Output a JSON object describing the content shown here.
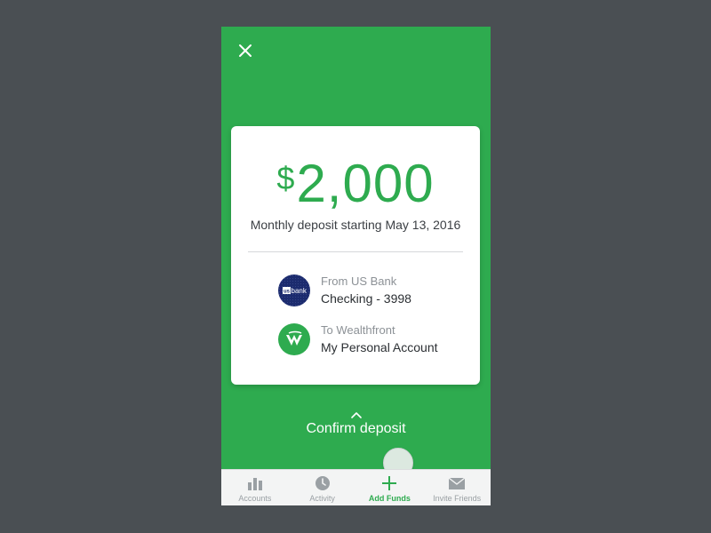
{
  "colors": {
    "brand_green": "#2eab4f",
    "backdrop": "#4a4f53",
    "usbank_blue": "#1c2b6e",
    "tab_inactive": "#9aa0a4"
  },
  "deposit": {
    "currency_symbol": "$",
    "amount": "2,000",
    "subtitle": "Monthly deposit starting May 13, 2016"
  },
  "from_account": {
    "label": "From US Bank",
    "name": "Checking - 3998",
    "logo_text": "bank",
    "icon": "us-bank-logo"
  },
  "to_account": {
    "label": "To Wealthfront",
    "name": "My Personal Account",
    "icon": "wealthfront-logo"
  },
  "confirm": {
    "label": "Confirm deposit"
  },
  "tabs": [
    {
      "label": "Accounts",
      "icon": "bar-chart-icon",
      "active": false
    },
    {
      "label": "Activity",
      "icon": "clock-icon",
      "active": false
    },
    {
      "label": "Add Funds",
      "icon": "plus-icon",
      "active": true
    },
    {
      "label": "Invite Friends",
      "icon": "envelope-icon",
      "active": false
    }
  ]
}
